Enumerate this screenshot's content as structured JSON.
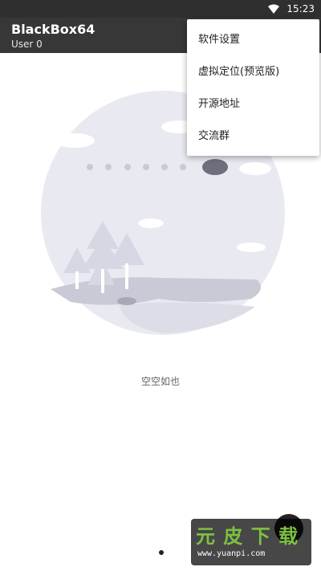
{
  "status_bar": {
    "time": "15:23",
    "wifi_icon": "wifi-icon"
  },
  "app_bar": {
    "title": "BlackBox64",
    "subtitle": "User 0"
  },
  "overflow_menu": {
    "items": [
      {
        "label": "软件设置"
      },
      {
        "label": "虚拟定位(预览版)"
      },
      {
        "label": "开源地址"
      },
      {
        "label": "交流群"
      }
    ]
  },
  "empty_state": {
    "message": "空空如也"
  },
  "watermark": {
    "logo": "元 皮 下 载",
    "url": "www.yuanpi.com"
  },
  "colors": {
    "app_bar": "#373737",
    "status_bar": "#2f2f2f",
    "illustration": "#e9e9f1"
  }
}
